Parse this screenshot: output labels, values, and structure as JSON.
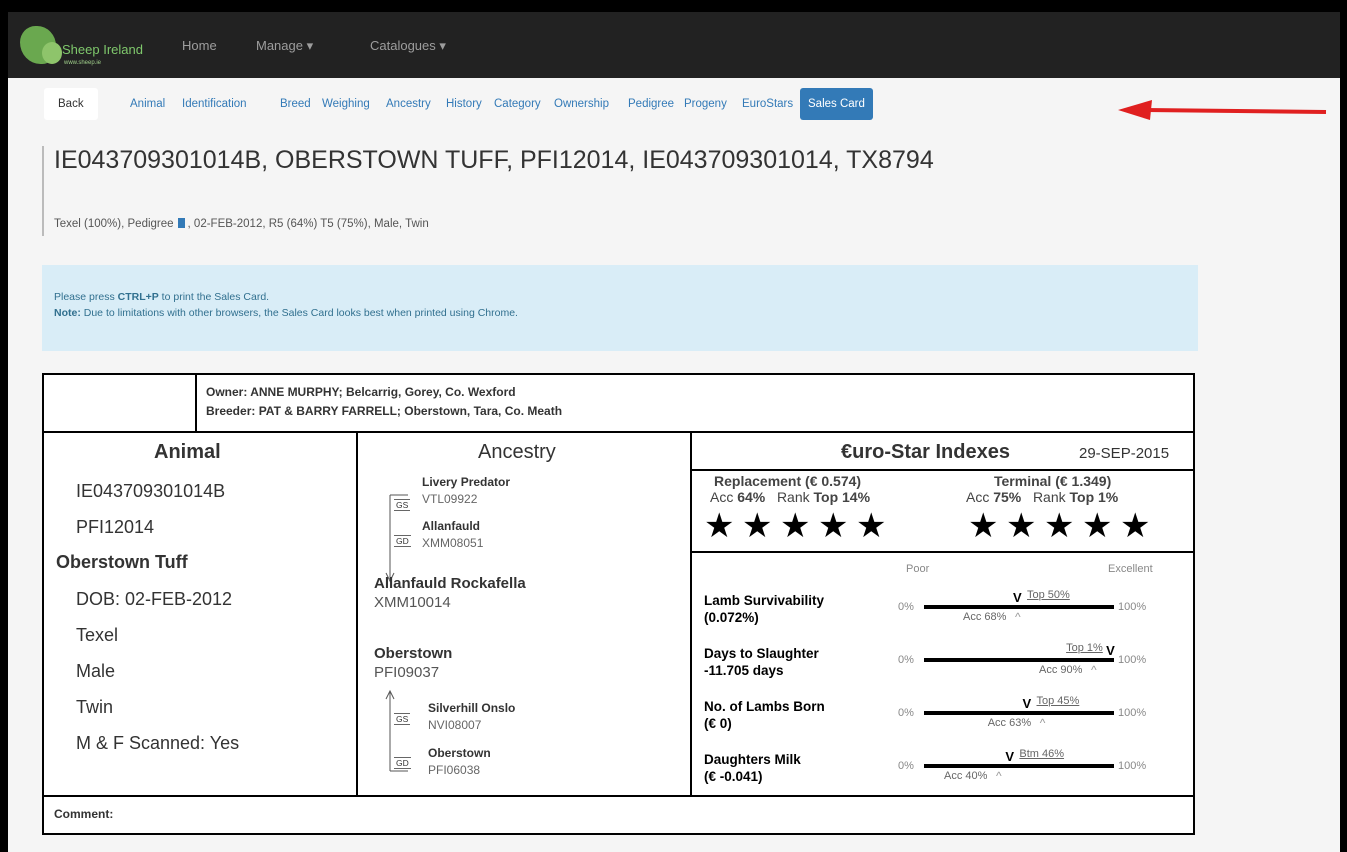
{
  "navbar": {
    "brand": "Sheep Ireland",
    "brand_url": "www.sheep.ie",
    "home": "Home",
    "manage": "Manage ▾",
    "catalogues": "Catalogues ▾"
  },
  "tabs": {
    "back": "Back",
    "items": [
      "Animal",
      "Identification",
      "Breed",
      "Weighing",
      "Ancestry",
      "History",
      "Category",
      "Ownership",
      "Pedigree",
      "Progeny",
      "EuroStars"
    ],
    "active": "Sales Card"
  },
  "header": {
    "title": "IE043709301014B, OBERSTOWN TUFF, PFI12014, IE043709301014, TX8794",
    "subtitle_a": "Texel (100%), Pedigree",
    "subtitle_b": ", 02-FEB-2012, R5 (64%) T5 (75%), Male, Twin"
  },
  "info": {
    "line1_a": "Please press ",
    "line1_b": "CTRL+P",
    "line1_c": " to print the Sales Card.",
    "line2_a": "Note:",
    "line2_b": " Due to limitations with other browsers, the Sales Card looks best when printed using Chrome."
  },
  "card": {
    "owner": "Owner: ANNE MURPHY; Belcarrig, Gorey, Co. Wexford",
    "breeder": "Breeder: PAT & BARRY FARRELL; Oberstown, Tara, Co. Meath",
    "animal": {
      "heading": "Animal",
      "tag": "IE043709301014B",
      "flock": "PFI12014",
      "name": "Oberstown Tuff",
      "dob": "DOB: 02-FEB-2012",
      "breed": "Texel",
      "sex": "Male",
      "birth_type": "Twin",
      "scanned": "M & F Scanned: Yes"
    },
    "ancestry": {
      "heading": "Ancestry",
      "gs1_label": "GS",
      "gs1_name": "Livery Predator",
      "gs1_code": "VTL09922",
      "gd1_label": "GD",
      "gd1_name": "Allanfauld",
      "gd1_code": "XMM08051",
      "sire_name": "Allanfauld Rockafella",
      "sire_code": "XMM10014",
      "dam_name": "Oberstown",
      "dam_code": "PFI09037",
      "gs2_label": "GS",
      "gs2_name": "Silverhill Onslo",
      "gs2_code": "NVI08007",
      "gd2_label": "GD",
      "gd2_name": "Oberstown",
      "gd2_code": "PFI06038"
    },
    "eurostar": {
      "heading": "€uro-Star Indexes",
      "date": "29-SEP-2015",
      "replacement": {
        "title": "Replacement (€ 0.574)",
        "acc_label": "Acc ",
        "acc": "64%",
        "rank_label": "Rank ",
        "rank": "Top 14%",
        "stars": 5
      },
      "terminal": {
        "title": "Terminal (€ 1.349)",
        "acc_label": "Acc ",
        "acc": "75%",
        "rank_label": "Rank ",
        "rank": "Top 1%",
        "stars": 5
      },
      "poor": "Poor",
      "excellent": "Excellent",
      "min": "0%",
      "max": "100%",
      "traits": [
        {
          "name": "Lamb Survivability",
          "value": "(0.072%)",
          "top": "Top 50%",
          "acc": "Acc 68%",
          "rank_pos": 0.5,
          "acc_pos": 0.5
        },
        {
          "name": "Days to Slaughter",
          "value": "-11.705 days",
          "top": "Top 1%",
          "acc": "Acc 90%",
          "rank_pos": 0.99,
          "acc_pos": 0.9
        },
        {
          "name": "No. of Lambs Born",
          "value": "(€ 0)",
          "top": "Top 45%",
          "acc": "Acc 63%",
          "rank_pos": 0.55,
          "acc_pos": 0.63
        },
        {
          "name": "Daughters Milk",
          "value": "(€ -0.041)",
          "top": "Btm 46%",
          "acc": "Acc 40%",
          "rank_pos": 0.46,
          "acc_pos": 0.4
        }
      ]
    },
    "comment": "Comment:"
  }
}
